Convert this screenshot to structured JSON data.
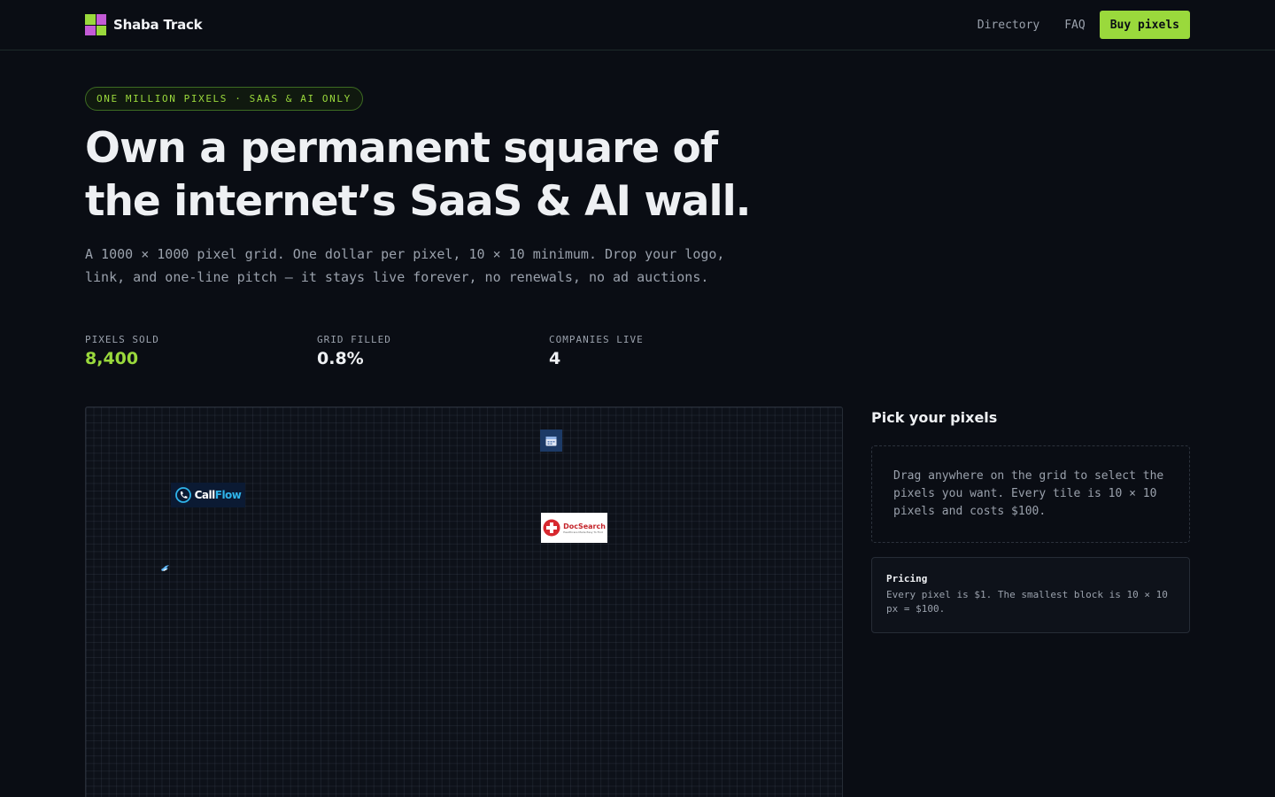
{
  "brand": {
    "name": "Shaba Track",
    "logo_colors": [
      "#9ad93c",
      "#c35bd6",
      "#c35bd6",
      "#9ad93c"
    ]
  },
  "nav": {
    "directory": "Directory",
    "faq": "FAQ",
    "buy": "Buy pixels"
  },
  "hero": {
    "badge": "ONE MILLION PIXELS · SAAS & AI ONLY",
    "headline": "Own a permanent square of the internet’s SaaS & AI wall.",
    "subtext": "A 1000 × 1000 pixel grid. One dollar per pixel, 10 × 10 minimum. Drop your logo, link, and one-line pitch — it stays live forever, no renewals, no ad auctions."
  },
  "stats": [
    {
      "label": "PIXELS SOLD",
      "value": "8,400"
    },
    {
      "label": "GRID FILLED",
      "value": "0.8%"
    },
    {
      "label": "COMPANIES LIVE",
      "value": "4"
    }
  ],
  "tiles": {
    "callflow": {
      "word1": "Call",
      "word2": "Flow"
    },
    "docsearch": {
      "name": "DocSearch",
      "tagline": "Healthcare Made Easy To Find"
    },
    "calendar": {
      "icon": "calendar-icon"
    },
    "bird": {
      "icon": "bird-icon"
    }
  },
  "panel": {
    "title": "Pick your pixels",
    "instructions": "Drag anywhere on the grid to select the pixels you want. Every tile is 10 × 10 pixels and costs $100.",
    "pricing_title": "Pricing",
    "pricing_text": "Every pixel is $1. The smallest block is 10 × 10 px = $100."
  },
  "colors": {
    "accent": "#9ad93c",
    "background": "#0a0d14",
    "muted_text": "#9aa1ac"
  }
}
